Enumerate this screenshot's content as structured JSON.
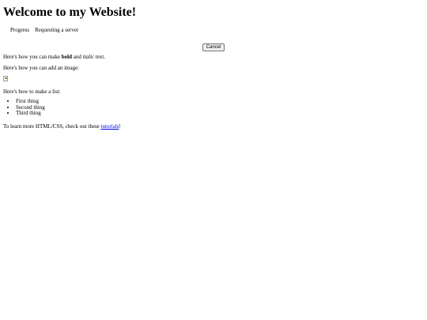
{
  "heading": "Welcome to my Website!",
  "progress": {
    "image_alt": "Progress",
    "status": "Requesting a server",
    "cancel_label": "Cancel"
  },
  "formatting": {
    "before": "Here's how you can make ",
    "bold": "bold",
    "middle": " and ",
    "italic": "italic",
    "after": " text."
  },
  "image_intro": "Here's how you can add an image:",
  "list_intro": "Here's how to make a list:",
  "list_items": [
    "First thing",
    "Second thing",
    "Third thing"
  ],
  "learn_more": {
    "before": "To learn more HTML/CSS, check out these ",
    "link": "tutorials",
    "after": "!"
  }
}
